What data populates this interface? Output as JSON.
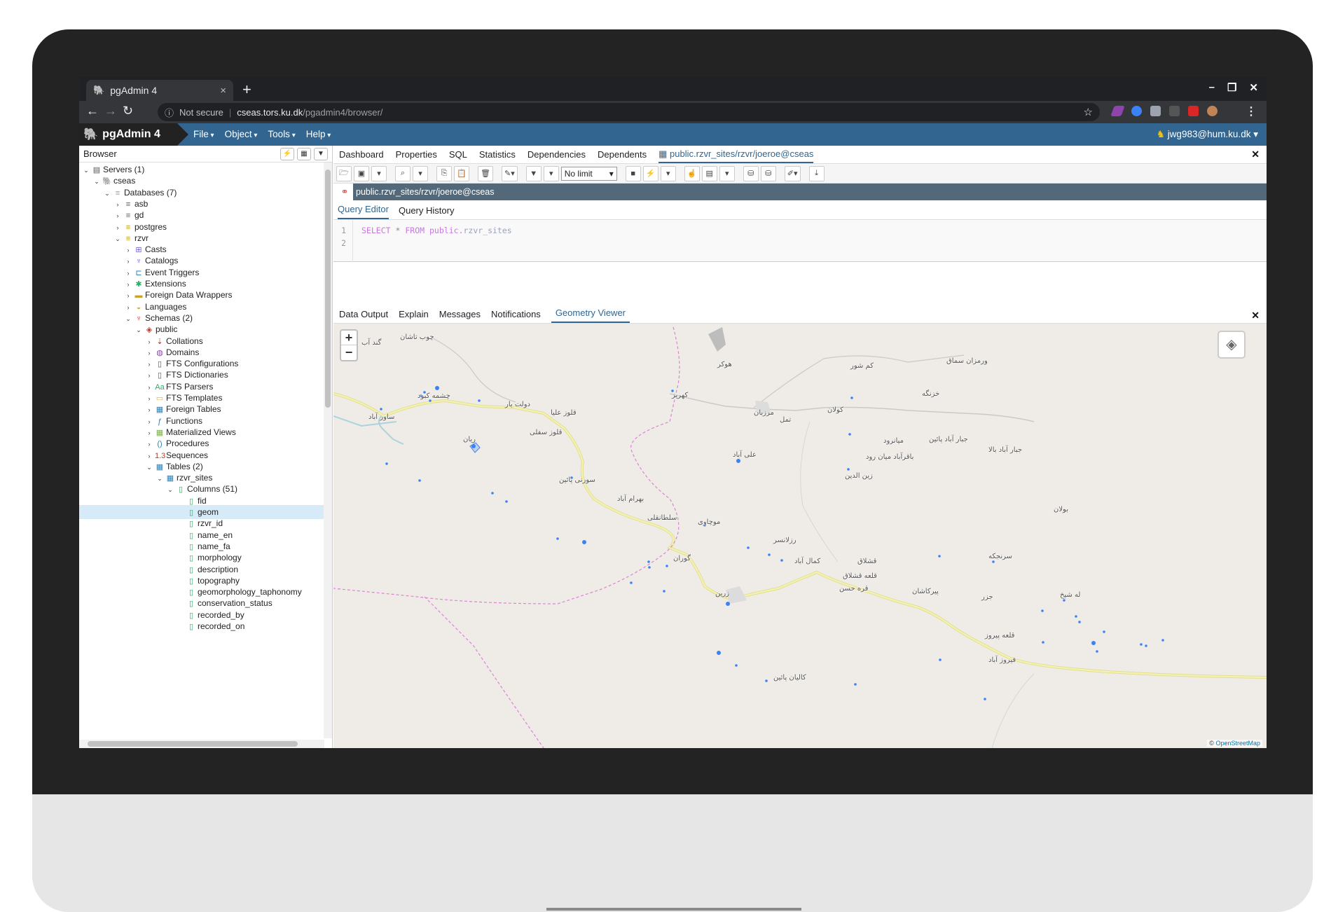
{
  "browser": {
    "tab_title": "pgAdmin 4",
    "tab_close": "×",
    "new_tab": "+",
    "url_security": "Not secure",
    "url_host": "cseas.tors.ku.dk",
    "url_path": "/pgadmin4/browser/"
  },
  "app": {
    "brand": "pgAdmin 4",
    "menus": [
      "File",
      "Object",
      "Tools",
      "Help"
    ],
    "user": "jwg983@hum.ku.dk"
  },
  "left_panel": {
    "title": "Browser",
    "tree": [
      {
        "label": "Servers (1)",
        "depth": 0,
        "open": true,
        "icon": "▤",
        "color": "#555"
      },
      {
        "label": "cseas",
        "depth": 1,
        "open": true,
        "icon": "🐘",
        "color": "#336791"
      },
      {
        "label": "Databases (7)",
        "depth": 2,
        "open": true,
        "icon": "≡",
        "color": "#c9a227"
      },
      {
        "label": "asb",
        "depth": 3,
        "open": false,
        "icon": "≡",
        "color": "#c0392b"
      },
      {
        "label": "gd",
        "depth": 3,
        "open": false,
        "icon": "≡",
        "color": "#c0392b"
      },
      {
        "label": "postgres",
        "depth": 3,
        "open": false,
        "icon": "≡",
        "color": "#c9a227"
      },
      {
        "label": "rzvr",
        "depth": 3,
        "open": true,
        "icon": "≡",
        "color": "#c9a227"
      },
      {
        "label": "Casts",
        "depth": 4,
        "open": false,
        "icon": "⊞",
        "color": "#6c5ce7"
      },
      {
        "label": "Catalogs",
        "depth": 4,
        "open": false,
        "icon": "♆",
        "color": "#6c5ce7"
      },
      {
        "label": "Event Triggers",
        "depth": 4,
        "open": false,
        "icon": "⊏",
        "color": "#2980b9"
      },
      {
        "label": "Extensions",
        "depth": 4,
        "open": false,
        "icon": "✱",
        "color": "#27ae60"
      },
      {
        "label": "Foreign Data Wrappers",
        "depth": 4,
        "open": false,
        "icon": "▬",
        "color": "#c9a227"
      },
      {
        "label": "Languages",
        "depth": 4,
        "open": false,
        "icon": "◒",
        "color": "#e1b12c"
      },
      {
        "label": "Schemas (2)",
        "depth": 4,
        "open": true,
        "icon": "♆",
        "color": "#c0392b"
      },
      {
        "label": "public",
        "depth": 5,
        "open": true,
        "icon": "◈",
        "color": "#c0392b"
      },
      {
        "label": "Collations",
        "depth": 6,
        "open": false,
        "icon": "⇣",
        "color": "#c0392b"
      },
      {
        "label": "Domains",
        "depth": 6,
        "open": false,
        "icon": "◍",
        "color": "#8e44ad"
      },
      {
        "label": "FTS Configurations",
        "depth": 6,
        "open": false,
        "icon": "▯",
        "color": "#555"
      },
      {
        "label": "FTS Dictionaries",
        "depth": 6,
        "open": false,
        "icon": "▯",
        "color": "#555"
      },
      {
        "label": "FTS Parsers",
        "depth": 6,
        "open": false,
        "icon": "Aa",
        "color": "#27ae60"
      },
      {
        "label": "FTS Templates",
        "depth": 6,
        "open": false,
        "icon": "▭",
        "color": "#e1b12c"
      },
      {
        "label": "Foreign Tables",
        "depth": 6,
        "open": false,
        "icon": "▦",
        "color": "#2980b9"
      },
      {
        "label": "Functions",
        "depth": 6,
        "open": false,
        "icon": "ƒ",
        "color": "#2980b9"
      },
      {
        "label": "Materialized Views",
        "depth": 6,
        "open": false,
        "icon": "▦",
        "color": "#7cb342"
      },
      {
        "label": "Procedures",
        "depth": 6,
        "open": false,
        "icon": "()",
        "color": "#2980b9"
      },
      {
        "label": "Sequences",
        "depth": 6,
        "open": false,
        "icon": "1.3",
        "color": "#c0392b"
      },
      {
        "label": "Tables (2)",
        "depth": 6,
        "open": true,
        "icon": "▦",
        "color": "#2980b9"
      },
      {
        "label": "rzvr_sites",
        "depth": 7,
        "open": true,
        "icon": "▦",
        "color": "#2980b9"
      },
      {
        "label": "Columns (51)",
        "depth": 8,
        "open": true,
        "icon": "▯",
        "color": "#27ae60"
      },
      {
        "label": "fid",
        "depth": 9,
        "icon": "▯",
        "color": "#27ae60"
      },
      {
        "label": "geom",
        "depth": 9,
        "icon": "▯",
        "color": "#27ae60",
        "selected": true
      },
      {
        "label": "rzvr_id",
        "depth": 9,
        "icon": "▯",
        "color": "#27ae60"
      },
      {
        "label": "name_en",
        "depth": 9,
        "icon": "▯",
        "color": "#27ae60"
      },
      {
        "label": "name_fa",
        "depth": 9,
        "icon": "▯",
        "color": "#27ae60"
      },
      {
        "label": "morphology",
        "depth": 9,
        "icon": "▯",
        "color": "#27ae60"
      },
      {
        "label": "description",
        "depth": 9,
        "icon": "▯",
        "color": "#27ae60"
      },
      {
        "label": "topography",
        "depth": 9,
        "icon": "▯",
        "color": "#27ae60"
      },
      {
        "label": "geomorphology_taphonomy",
        "depth": 9,
        "icon": "▯",
        "color": "#27ae60"
      },
      {
        "label": "conservation_status",
        "depth": 9,
        "icon": "▯",
        "color": "#27ae60"
      },
      {
        "label": "recorded_by",
        "depth": 9,
        "icon": "▯",
        "color": "#27ae60"
      },
      {
        "label": "recorded_on",
        "depth": 9,
        "icon": "▯",
        "color": "#27ae60"
      }
    ]
  },
  "main_tabs": [
    "Dashboard",
    "Properties",
    "SQL",
    "Statistics",
    "Dependencies",
    "Dependents"
  ],
  "query_tab_title": "public.rzvr_sites/rzvr/joeroe@cseas",
  "toolbar": {
    "limit": "No limit"
  },
  "connection": "public.rzvr_sites/rzvr/joeroe@cseas",
  "query_tabs": [
    "Query Editor",
    "Query History"
  ],
  "editor": {
    "line_numbers": [
      "1",
      "2"
    ],
    "kw_select": "SELECT",
    "star": "*",
    "kw_from": "FROM",
    "schema": "public.",
    "table": "rzvr_sites"
  },
  "output_tabs": [
    "Data Output",
    "Explain",
    "Messages",
    "Notifications"
  ],
  "output_active_tab": "Geometry Viewer",
  "map": {
    "zoom_in": "+",
    "zoom_out": "−",
    "attribution_prefix": "©",
    "attribution_link": "OpenStreetMap",
    "place_names": [
      "گند آب",
      "چوب تاشان",
      "هوکر",
      "کم شور",
      "ورمزان سماق",
      "چشمه کبود",
      "ساور آباد",
      "دولت یار",
      "قلوز علیا",
      "قلوز سفلی",
      "ریان",
      "کهریز",
      "مرزبان",
      "تمل",
      "کولان",
      "خزنگه",
      "میانرود",
      "باقرآباد میان رود",
      "جبار آباد پائین",
      "جبار آباد بالا",
      "علی آباد",
      "زین الدین",
      "سورنی پائین",
      "بهرام آباد",
      "سلطانقلی",
      "موچاوی",
      "گوران",
      "بولان",
      "رزلانسر",
      "کمال آباد",
      "قشلاق",
      "قلعه قشلاق",
      "سرنجکه",
      "قره حسن",
      "پیرکاشان",
      "جزر",
      "له شیخ",
      "زرین",
      "قلعه پیروز",
      "فیروز آباد",
      "کالیان پائین"
    ],
    "site_count": 48,
    "colors": {
      "road": "#e8e79a",
      "boundary": "#d985d3",
      "site": "#3b82f6",
      "water": "#aad3df"
    }
  }
}
